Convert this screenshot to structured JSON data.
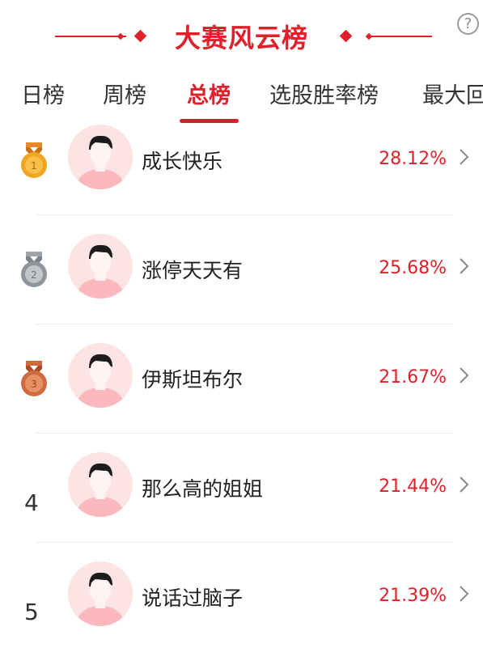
{
  "header": {
    "title": "大赛风云榜",
    "help_symbol": "?",
    "accent_color": "#e0202b"
  },
  "tabs": [
    {
      "label": "日榜",
      "active": false
    },
    {
      "label": "周榜",
      "active": false
    },
    {
      "label": "总榜",
      "active": true
    },
    {
      "label": "选股胜率榜",
      "active": false
    },
    {
      "label": "最大回",
      "active": false
    }
  ],
  "leaderboard": [
    {
      "rank": "1",
      "medal": "gold",
      "name": "成长快乐",
      "rate": "28.12%"
    },
    {
      "rank": "2",
      "medal": "silver",
      "name": "涨停天天有",
      "rate": "25.68%"
    },
    {
      "rank": "3",
      "medal": "bronze",
      "name": "伊斯坦布尔",
      "rate": "21.67%"
    },
    {
      "rank": "4",
      "medal": null,
      "name": "那么高的姐姐",
      "rate": "21.44%"
    },
    {
      "rank": "5",
      "medal": null,
      "name": "说话过脑子",
      "rate": "21.39%"
    }
  ],
  "icons": {
    "help": "help-icon",
    "chevron": "chevron-right-icon",
    "avatar": "default-avatar-icon",
    "medal": "medal-icon"
  }
}
